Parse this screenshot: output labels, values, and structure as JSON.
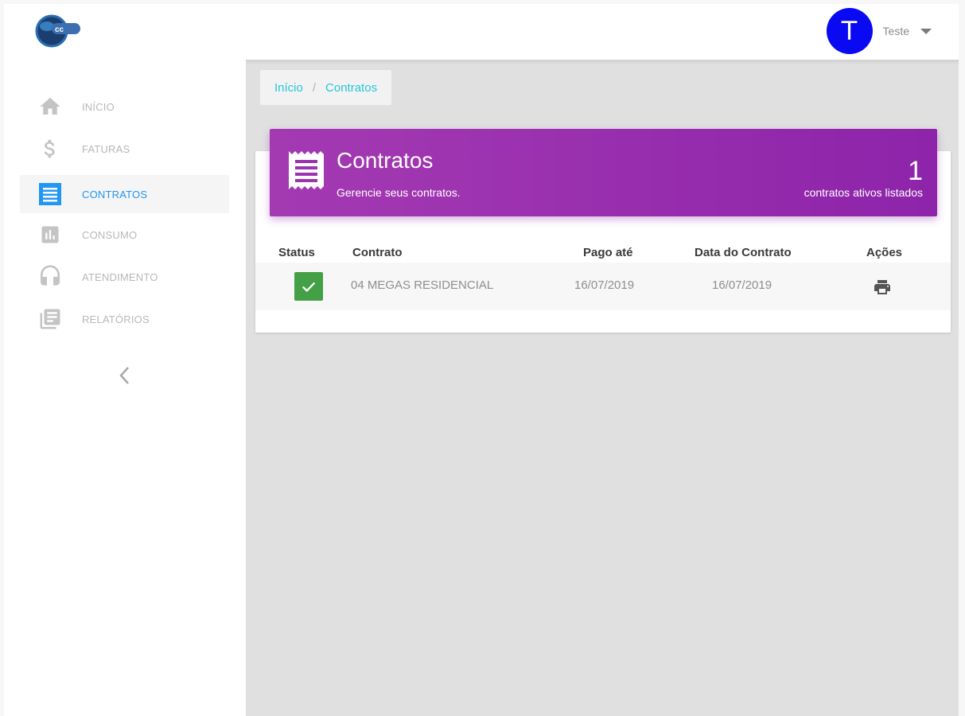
{
  "header": {
    "user_initial": "T",
    "user_name": "Teste"
  },
  "sidebar": {
    "items": [
      {
        "label": "INÍCIO",
        "icon": "home-icon"
      },
      {
        "label": "FATURAS",
        "icon": "dollar-icon"
      },
      {
        "label": "CONTRATOS",
        "icon": "list-icon",
        "active": true
      },
      {
        "label": "CONSUMO",
        "icon": "bar-chart-icon"
      },
      {
        "label": "ATENDIMENTO",
        "icon": "headset-icon"
      },
      {
        "label": "RELATÓRIOS",
        "icon": "report-icon"
      }
    ]
  },
  "breadcrumb": {
    "home": "Início",
    "separator": "/",
    "current": "Contratos"
  },
  "banner": {
    "title": "Contratos",
    "subtitle": "Gerencie seus contratos.",
    "count": "1",
    "count_label": "contratos ativos listados"
  },
  "table": {
    "headers": [
      "Status",
      "Contrato",
      "Pago até",
      "Data do Contrato",
      "Ações"
    ],
    "rows": [
      {
        "contrato": "04 MEGAS RESIDENCIAL",
        "pago_ate": "16/07/2019",
        "data_contrato": "16/07/2019"
      }
    ]
  },
  "colors": {
    "accent": "#2196f3",
    "banner": "#9c33b0",
    "status_ok": "#43a047",
    "avatar": "#0a0af2"
  }
}
